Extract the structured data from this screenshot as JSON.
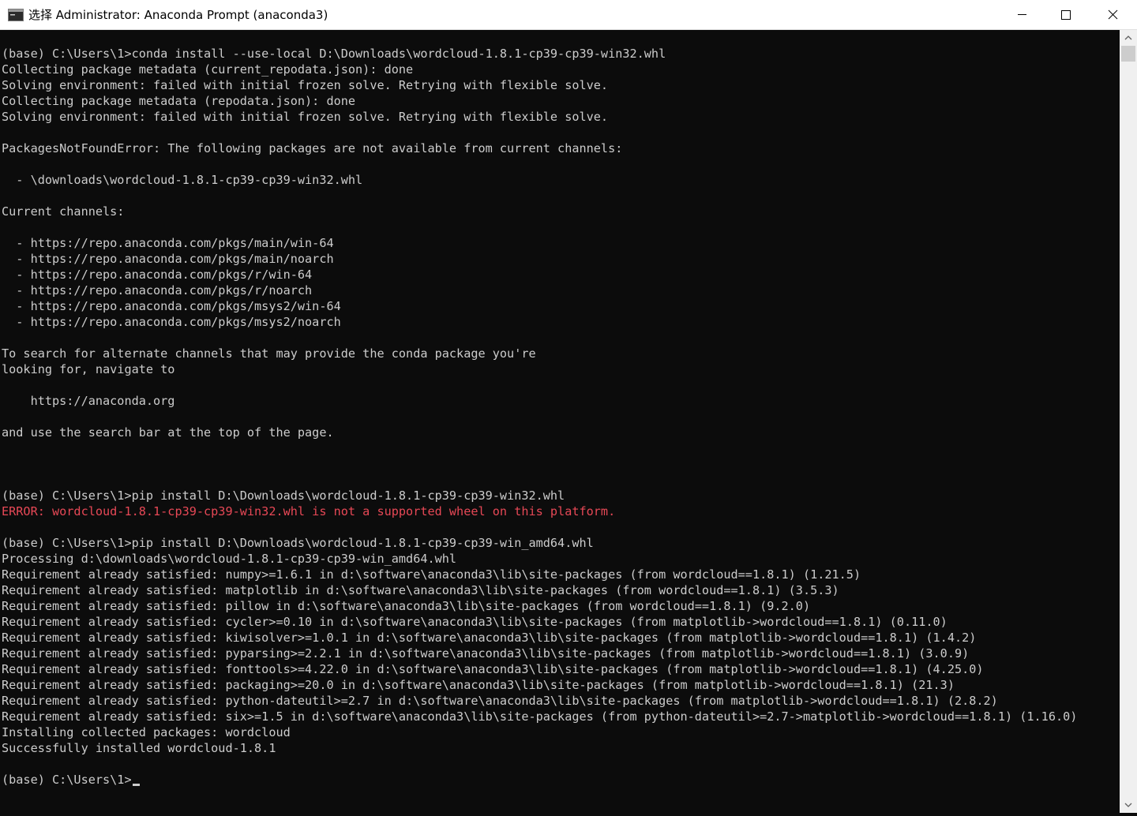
{
  "window": {
    "title": "选择 Administrator: Anaconda Prompt (anaconda3)",
    "icon": "console-icon",
    "controls": [
      "minimize-icon",
      "maximize-icon",
      "close-icon"
    ]
  },
  "console": {
    "lines": [
      {
        "text": "(base) C:\\Users\\1>conda install --use-local D:\\Downloads\\wordcloud-1.8.1-cp39-cp39-win32.whl",
        "type": "normal"
      },
      {
        "text": "Collecting package metadata (current_repodata.json): done",
        "type": "normal"
      },
      {
        "text": "Solving environment: failed with initial frozen solve. Retrying with flexible solve.",
        "type": "normal"
      },
      {
        "text": "Collecting package metadata (repodata.json): done",
        "type": "normal"
      },
      {
        "text": "Solving environment: failed with initial frozen solve. Retrying with flexible solve.",
        "type": "normal"
      },
      {
        "text": "",
        "type": "normal"
      },
      {
        "text": "PackagesNotFoundError: The following packages are not available from current channels:",
        "type": "normal"
      },
      {
        "text": "",
        "type": "normal"
      },
      {
        "text": "  - \\downloads\\wordcloud-1.8.1-cp39-cp39-win32.whl",
        "type": "normal"
      },
      {
        "text": "",
        "type": "normal"
      },
      {
        "text": "Current channels:",
        "type": "normal"
      },
      {
        "text": "",
        "type": "normal"
      },
      {
        "text": "  - https://repo.anaconda.com/pkgs/main/win-64",
        "type": "normal"
      },
      {
        "text": "  - https://repo.anaconda.com/pkgs/main/noarch",
        "type": "normal"
      },
      {
        "text": "  - https://repo.anaconda.com/pkgs/r/win-64",
        "type": "normal"
      },
      {
        "text": "  - https://repo.anaconda.com/pkgs/r/noarch",
        "type": "normal"
      },
      {
        "text": "  - https://repo.anaconda.com/pkgs/msys2/win-64",
        "type": "normal"
      },
      {
        "text": "  - https://repo.anaconda.com/pkgs/msys2/noarch",
        "type": "normal"
      },
      {
        "text": "",
        "type": "normal"
      },
      {
        "text": "To search for alternate channels that may provide the conda package you're",
        "type": "normal"
      },
      {
        "text": "looking for, navigate to",
        "type": "normal"
      },
      {
        "text": "",
        "type": "normal"
      },
      {
        "text": "    https://anaconda.org",
        "type": "normal"
      },
      {
        "text": "",
        "type": "normal"
      },
      {
        "text": "and use the search bar at the top of the page.",
        "type": "normal"
      },
      {
        "text": "",
        "type": "normal"
      },
      {
        "text": "",
        "type": "normal"
      },
      {
        "text": "",
        "type": "normal"
      },
      {
        "text": "(base) C:\\Users\\1>pip install D:\\Downloads\\wordcloud-1.8.1-cp39-cp39-win32.whl",
        "type": "normal"
      },
      {
        "text": "ERROR: wordcloud-1.8.1-cp39-cp39-win32.whl is not a supported wheel on this platform.",
        "type": "error"
      },
      {
        "text": "",
        "type": "normal"
      },
      {
        "text": "(base) C:\\Users\\1>pip install D:\\Downloads\\wordcloud-1.8.1-cp39-cp39-win_amd64.whl",
        "type": "normal"
      },
      {
        "text": "Processing d:\\downloads\\wordcloud-1.8.1-cp39-cp39-win_amd64.whl",
        "type": "normal"
      },
      {
        "text": "Requirement already satisfied: numpy>=1.6.1 in d:\\software\\anaconda3\\lib\\site-packages (from wordcloud==1.8.1) (1.21.5)",
        "type": "normal"
      },
      {
        "text": "Requirement already satisfied: matplotlib in d:\\software\\anaconda3\\lib\\site-packages (from wordcloud==1.8.1) (3.5.3)",
        "type": "normal"
      },
      {
        "text": "Requirement already satisfied: pillow in d:\\software\\anaconda3\\lib\\site-packages (from wordcloud==1.8.1) (9.2.0)",
        "type": "normal"
      },
      {
        "text": "Requirement already satisfied: cycler>=0.10 in d:\\software\\anaconda3\\lib\\site-packages (from matplotlib->wordcloud==1.8.1) (0.11.0)",
        "type": "normal"
      },
      {
        "text": "Requirement already satisfied: kiwisolver>=1.0.1 in d:\\software\\anaconda3\\lib\\site-packages (from matplotlib->wordcloud==1.8.1) (1.4.2)",
        "type": "normal"
      },
      {
        "text": "Requirement already satisfied: pyparsing>=2.2.1 in d:\\software\\anaconda3\\lib\\site-packages (from matplotlib->wordcloud==1.8.1) (3.0.9)",
        "type": "normal"
      },
      {
        "text": "Requirement already satisfied: fonttools>=4.22.0 in d:\\software\\anaconda3\\lib\\site-packages (from matplotlib->wordcloud==1.8.1) (4.25.0)",
        "type": "normal"
      },
      {
        "text": "Requirement already satisfied: packaging>=20.0 in d:\\software\\anaconda3\\lib\\site-packages (from matplotlib->wordcloud==1.8.1) (21.3)",
        "type": "normal"
      },
      {
        "text": "Requirement already satisfied: python-dateutil>=2.7 in d:\\software\\anaconda3\\lib\\site-packages (from matplotlib->wordcloud==1.8.1) (2.8.2)",
        "type": "normal"
      },
      {
        "text": "Requirement already satisfied: six>=1.5 in d:\\software\\anaconda3\\lib\\site-packages (from python-dateutil>=2.7->matplotlib->wordcloud==1.8.1) (1.16.0)",
        "type": "normal"
      },
      {
        "text": "Installing collected packages: wordcloud",
        "type": "normal"
      },
      {
        "text": "Successfully installed wordcloud-1.8.1",
        "type": "normal"
      },
      {
        "text": "",
        "type": "normal"
      }
    ],
    "prompt": "(base) C:\\Users\\1>"
  },
  "colors": {
    "background": "#0c0c0c",
    "text": "#cccccc",
    "error": "#e74856"
  }
}
